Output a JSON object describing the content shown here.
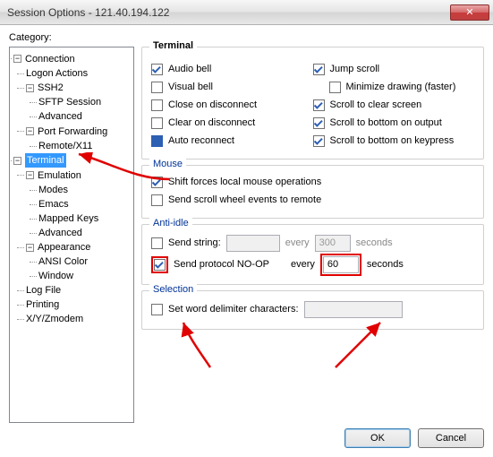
{
  "window": {
    "title": "Session Options - 121.40.194.122",
    "close_x": "✕"
  },
  "category_label": "Category:",
  "tree": {
    "connection": "Connection",
    "logon_actions": "Logon Actions",
    "ssh2": "SSH2",
    "sftp_session": "SFTP Session",
    "ssh2_advanced": "Advanced",
    "port_forwarding": "Port Forwarding",
    "remote_x11": "Remote/X11",
    "terminal": "Terminal",
    "emulation": "Emulation",
    "modes": "Modes",
    "emacs": "Emacs",
    "mapped_keys": "Mapped Keys",
    "emu_advanced": "Advanced",
    "appearance": "Appearance",
    "ansi_color": "ANSI Color",
    "window": "Window",
    "log_file": "Log File",
    "printing": "Printing",
    "xyzmodem": "X/Y/Zmodem"
  },
  "expander": {
    "minus": "−"
  },
  "terminal": {
    "legend": "Terminal",
    "audio_bell": "Audio bell",
    "visual_bell": "Visual bell",
    "close_on_disconnect": "Close on disconnect",
    "clear_on_disconnect": "Clear on disconnect",
    "auto_reconnect": "Auto reconnect",
    "jump_scroll": "Jump scroll",
    "minimize_drawing": "Minimize drawing (faster)",
    "scroll_clear": "Scroll to clear screen",
    "scroll_output": "Scroll to bottom on output",
    "scroll_keypress": "Scroll to bottom on keypress"
  },
  "mouse": {
    "legend": "Mouse",
    "shift_local": "Shift forces local mouse operations",
    "send_wheel": "Send scroll wheel events to remote"
  },
  "antiidle": {
    "legend": "Anti-idle",
    "send_string": "Send string:",
    "send_string_value": "",
    "every1": "every",
    "send_string_interval": "300",
    "seconds1": "seconds",
    "protocol_noop": "Send protocol NO-OP",
    "every2": "every",
    "noop_interval": "60",
    "seconds2": "seconds"
  },
  "selection": {
    "legend": "Selection",
    "word_delim": "Set word delimiter characters:",
    "word_delim_value": ""
  },
  "buttons": {
    "ok": "OK",
    "cancel": "Cancel"
  }
}
